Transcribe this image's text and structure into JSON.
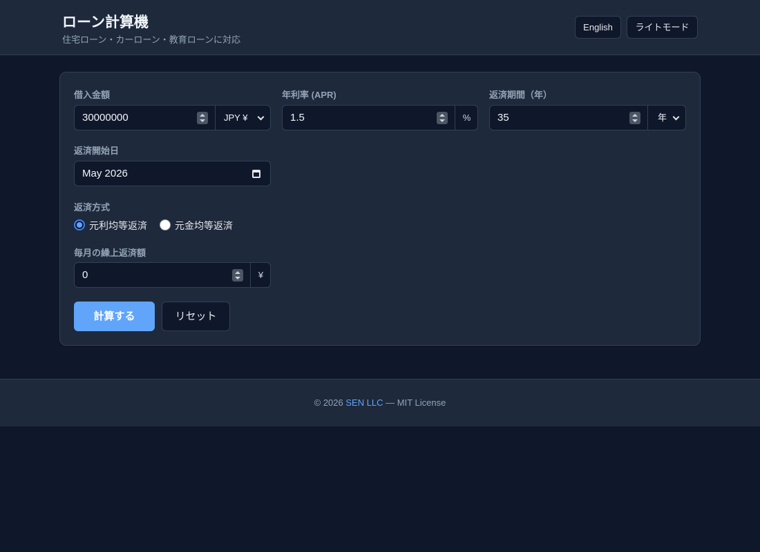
{
  "header": {
    "title": "ローン計算機",
    "subtitle": "住宅ローン・カーローン・教育ローンに対応",
    "lang_button": "English",
    "theme_button": "ライトモード"
  },
  "form": {
    "amount": {
      "label": "借入金額",
      "value": "30000000",
      "currency": "JPY ¥"
    },
    "rate": {
      "label": "年利率 (APR)",
      "value": "1.5",
      "suffix": "%"
    },
    "term": {
      "label": "返済期間（年）",
      "value": "35",
      "unit": "年"
    },
    "start_date": {
      "label": "返済開始日",
      "value": "May 2026"
    },
    "method": {
      "label": "返済方式",
      "options": [
        {
          "label": "元利均等返済",
          "selected": true
        },
        {
          "label": "元金均等返済",
          "selected": false
        }
      ]
    },
    "extra": {
      "label": "毎月の繰上返済額",
      "value": "0",
      "suffix": "¥"
    },
    "calculate_button": "計算する",
    "reset_button": "リセット"
  },
  "footer": {
    "prefix": "© 2026 ",
    "company": "SEN LLC",
    "suffix": " — MIT License"
  },
  "colors": {
    "background": "#0f172a",
    "surface": "#1e293b",
    "accent": "#60a5fa",
    "border": "#334155"
  }
}
